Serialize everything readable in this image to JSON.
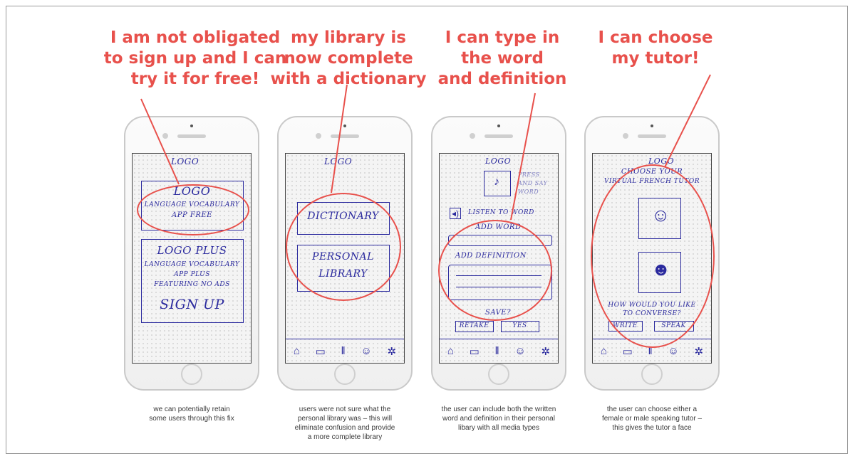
{
  "colors": {
    "accent": "#e8514c",
    "ink": "#2b2a9e",
    "caption": "#3a3a3a"
  },
  "panels": [
    {
      "headline": [
        "I am not obligated",
        "to sign up and I can",
        "try it for free!"
      ],
      "caption": [
        "we can potentially retain",
        "some users through this fix"
      ],
      "screen": {
        "top_logo": "LOGO",
        "free_box": [
          "LOGO",
          "LANGUAGE VOCABULARY",
          "APP FREE"
        ],
        "plus_box": [
          "LOGO PLUS",
          "LANGUAGE VOCABULARY",
          "APP PLUS",
          "FEATURING NO ADS"
        ],
        "sign_up": "SIGN UP"
      }
    },
    {
      "headline": [
        "my library is",
        "now complete",
        "with a dictionary"
      ],
      "caption": [
        "users were not sure what the",
        "personal library was – this will",
        "eliminate confusion and provide",
        "a more complete library"
      ],
      "screen": {
        "top_logo": "LOGO",
        "dictionary": "DICTIONARY",
        "personal_library": [
          "PERSONAL",
          "LIBRARY"
        ]
      }
    },
    {
      "headline": [
        "I can type in",
        "the word",
        "and definition"
      ],
      "caption": [
        "the user can include both the written",
        "word and definition in their personal",
        "libary with all media types"
      ],
      "screen": {
        "top_logo": "LOGO",
        "press_say": [
          "PRESS",
          "AND SAY",
          "WORD"
        ],
        "listen": "LISTEN TO WORD",
        "add_word": "ADD WORD",
        "add_definition": "ADD DEFINITION",
        "save": "SAVE?",
        "retake": "RETAKE",
        "yes": "YES"
      }
    },
    {
      "headline": [
        "I can choose",
        "my tutor!"
      ],
      "caption": [
        "the user can choose either a",
        "female or male speaking tutor –",
        "this gives the tutor a face"
      ],
      "screen": {
        "top_logo": "LOGO",
        "choose": [
          "CHOOSE YOUR",
          "VIRTUAL FRENCH TUTOR"
        ],
        "converse": [
          "HOW WOULD YOU LIKE",
          "TO CONVERSE?"
        ],
        "write": "WRITE",
        "speak": "SPEAK"
      }
    }
  ],
  "nav_icons": [
    "home-sketch-icon",
    "chat-sketch-icon",
    "books-sketch-icon",
    "people-sketch-icon",
    "gear-sketch-icon"
  ]
}
